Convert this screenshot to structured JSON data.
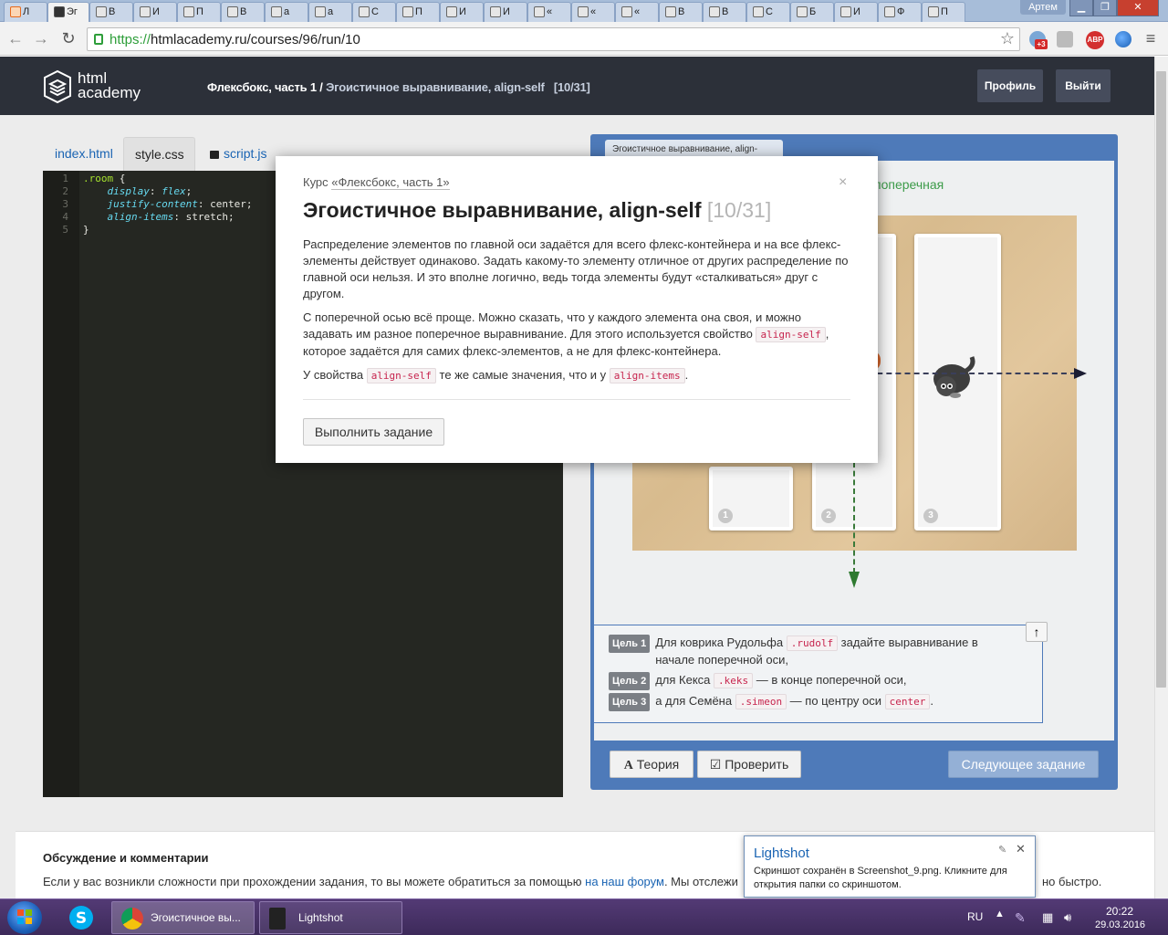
{
  "browser": {
    "tabs": [
      {
        "label": "Л"
      },
      {
        "label": "Эг"
      },
      {
        "label": "В"
      },
      {
        "label": "И"
      },
      {
        "label": "П"
      },
      {
        "label": "В"
      },
      {
        "label": "а"
      },
      {
        "label": "а"
      },
      {
        "label": "С"
      },
      {
        "label": "П"
      },
      {
        "label": "И"
      },
      {
        "label": "И"
      },
      {
        "label": "«"
      },
      {
        "label": "«"
      },
      {
        "label": "«"
      },
      {
        "label": "В"
      },
      {
        "label": "В"
      },
      {
        "label": "С"
      },
      {
        "label": "Б"
      },
      {
        "label": "И"
      },
      {
        "label": "Ф"
      },
      {
        "label": "П"
      }
    ],
    "user": "Артем",
    "url_scheme": "https://",
    "url_rest": "htmlacademy.ru/courses/96/run/10",
    "ext_badge": "+3",
    "abp": "ABP"
  },
  "header": {
    "logo_line1": "html",
    "logo_line2": "academy",
    "crumb_course": "Флексбокс, часть 1",
    "crumb_sep": " / ",
    "crumb_task": "Эгоистичное выравнивание, align-self",
    "crumb_count": "[10/31]",
    "profile": "Профиль",
    "logout": "Выйти"
  },
  "editor": {
    "tabs": [
      "index.html",
      "style.css",
      "script.js"
    ],
    "line_numbers": [
      "1",
      "2",
      "3",
      "4",
      "5"
    ],
    "code": {
      "l1_sel": ".room",
      "l1_brace": " {",
      "l2_prop": "display",
      "l2_val": "flex",
      "l3_prop": "justify-content",
      "l3_val": " center;",
      "l4_prop": "align-items",
      "l4_val": " stretch;",
      "l5": "}"
    }
  },
  "preview": {
    "tab_label": "Эгоистичное выравнивание, align-",
    "cross_axis_label": "поперечная",
    "card_numbers": [
      "1",
      "2",
      "3"
    ],
    "goals": [
      {
        "badge": "Цель 1",
        "pre": "Для коврика Рудольфа ",
        "code": ".rudolf",
        "post": " задайте выравнивание в начале поперечной оси,"
      },
      {
        "badge": "Цель 2",
        "pre": "для Кекса ",
        "code": ".keks",
        "post": " — в конце поперечной оси,"
      },
      {
        "badge": "Цель 3",
        "pre": "а для Семёна ",
        "code": ".simeon",
        "post": " — по центру оси ",
        "code2": "center",
        "post2": "."
      }
    ],
    "btn_theory": "Теория",
    "btn_check": "Проверить",
    "btn_next": "Следующее задание"
  },
  "discussion": {
    "title": "Обсуждение и комментарии",
    "text": "Если у вас возникли сложности при прохождении задания, то вы можете обратиться за помощью ",
    "link": "на наш форум",
    "text2": ". Мы отслежи",
    "tail": "но быстро."
  },
  "modal": {
    "course_prefix": "Курс ",
    "course_link": "«Флексбокс, часть 1»",
    "close": "×",
    "title": "Эгоистичное выравнивание, align-self",
    "count": "[10/31]",
    "p1": "Распределение элементов по главной оси задаётся для всего флекс-контейнера и на все флекс-элементы действует одинаково. Задать какому-то элементу отличное от других распределение по главной оси нельзя. И это вполне логично, ведь тогда элементы будут «сталкиваться» друг с другом.",
    "p2a": "С поперечной осью всё проще. Можно сказать, что у каждого элемента она своя, и можно задавать им разное поперечное выравнивание. Для этого используется свойство ",
    "p2code": "align-self",
    "p2b": ", которое задаётся для самих флекс-элементов, а не для флекс-контейнера.",
    "p3a": "У свойства ",
    "p3code1": "align-self",
    "p3b": " те же самые значения, что и у ",
    "p3code2": "align-items",
    "p3c": ".",
    "button": "Выполнить задание"
  },
  "lightshot": {
    "title": "Lightshot",
    "message": "Скриншот сохранён в Screenshot_9.png. Кликните для открытия папки со скриншотом."
  },
  "taskbar": {
    "items": [
      "Эгоистичное вы...",
      "Lightshot"
    ],
    "lang": "RU",
    "time": "20:22",
    "date": "29.03.2016"
  },
  "colors": {
    "accent": "#4e7ab9",
    "header": "#2c3039",
    "link": "#1a64b3",
    "code_red": "#c7254e"
  }
}
